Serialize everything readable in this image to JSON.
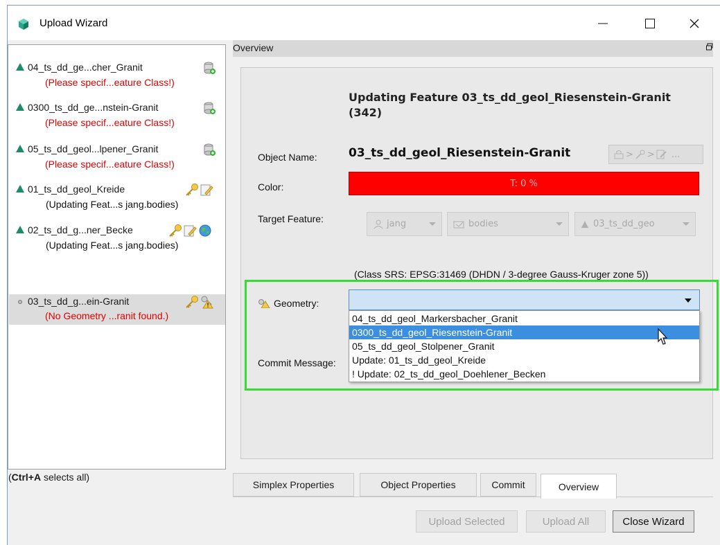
{
  "window": {
    "title": "Upload Wizard",
    "minimize_glyph": "—",
    "maximize_glyph": "☐",
    "close_glyph": "✕"
  },
  "tree": {
    "items": [
      {
        "label": "04_ts_dd_ge...cher_Granit",
        "status": "(Please specif...eature Class!)",
        "status_type": "error",
        "icon": "database-add-icon"
      },
      {
        "label": "0300_ts_dd_ge...nstein-Granit",
        "status": "(Please specif...eature Class!)",
        "status_type": "error",
        "icon": "database-add-icon"
      },
      {
        "label": "05_ts_dd_geol...lpener_Granit",
        "status": "(Please specif...eature Class!)",
        "status_type": "error",
        "icon": "database-add-icon"
      },
      {
        "label": "01_ts_dd_geol_Kreide",
        "status": "(Updating Feat...s jang.bodies)",
        "status_type": "info",
        "icon": "key-edit-icon"
      },
      {
        "label": "02_ts_dd_g...ner_Becke",
        "status": "(Updating Feat...s jang.bodies)",
        "status_type": "info",
        "icon": "key-edit-globe-icon"
      },
      {
        "label": "03_ts_dd_g...ein-Granit",
        "status": "(No Geometry ...ranit found.)",
        "status_type": "error",
        "icon": "key-warning-icon",
        "selected": true
      }
    ],
    "hint_bold": "Ctrl+A",
    "hint_open": "(",
    "hint_rest": " selects all)"
  },
  "overview": {
    "header": "Overview",
    "heading": "Updating Feature 03_ts_dd_geol_Riesenstein-Granit (342)",
    "object_name_label": "Object Name:",
    "object_name": "03_ts_dd_geol_Riesenstein-Granit",
    "lock_button_more": "...",
    "color_label": "Color:",
    "color_value": "T: 0 %",
    "color_hex": "#ff0000",
    "target_feature_label": "Target Feature:",
    "target": {
      "user": "jang",
      "class": "bodies",
      "feature": "03_ts_dd_geo"
    },
    "srs_text": "(Class SRS: EPSG:31469 (DHDN / 3-degree Gauss-Kruger zone 5))",
    "geometry_label": "Geometry:",
    "geometry_value": "",
    "geometry_options": [
      "04_ts_dd_geol_Markersbacher_Granit",
      "0300_ts_dd_geol_Riesenstein-Granit",
      "05_ts_dd_geol_Stolpener_Granit",
      "Update: 01_ts_dd_geol_Kreide",
      "! Update: 02_ts_dd_geol_Doehlener_Becken"
    ],
    "geometry_highlighted_index": 1,
    "commit_message_label": "Commit Message:"
  },
  "tabs": [
    "Simplex Properties",
    "Object Properties",
    "Commit",
    "Overview"
  ],
  "active_tab": "Overview",
  "buttons": {
    "upload_selected": "Upload Selected",
    "upload_all": "Upload All",
    "close_wizard": "Close Wizard"
  },
  "colors": {
    "accent_highlight": "#3b8ee0",
    "error_text": "#e00000",
    "focus_box": "#33dd33",
    "tree_triangle": "#1f8a6a"
  }
}
